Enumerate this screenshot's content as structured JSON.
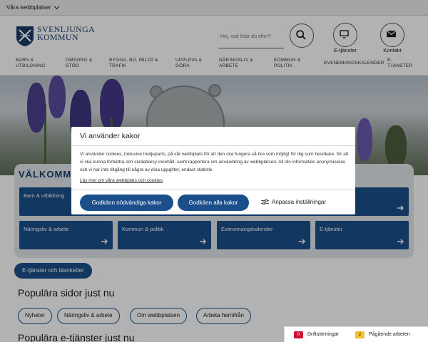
{
  "topbar": {
    "platforms_label": "Våra webbplatser"
  },
  "header": {
    "logo_line1": "SVENLJUNGA",
    "logo_line2": "KOMMUN",
    "search_placeholder": "Hej, vad letar du efter?",
    "etjanster_label": "E-tjänster",
    "kontakt_label": "Kontakt"
  },
  "nav": {
    "items": [
      {
        "line1": "Barn &",
        "line2": "utbildning"
      },
      {
        "line1": "Omsorg &",
        "line2": "stöd"
      },
      {
        "line1": "Bygga, bo, miljö &",
        "line2": "trafik"
      },
      {
        "line1": "Uppleva &",
        "line2": "göra"
      },
      {
        "line1": "Näringsliv &",
        "line2": "arbete"
      },
      {
        "line1": "Kommun &",
        "line2": "politik"
      },
      {
        "line1": "Evenemangskalender",
        "line2": ""
      },
      {
        "line1": "E-",
        "line2": "tjänster"
      }
    ]
  },
  "main": {
    "welcome": "Välkomme",
    "tiles_row1": [
      "Barn & utbildning"
    ],
    "tiles_row2": [
      "Näringsliv & arbete",
      "Kommun & politik",
      "Evenemangskalender",
      "E-tjänster"
    ],
    "etj_button": "E-tjänster och blanketter",
    "popular_heading": "Populära sidor just nu",
    "chips": [
      "Nyheter",
      "Näringsliv & arbete",
      "Om webbplatsen",
      "Arbeta hemifrån"
    ],
    "popular_eservices_heading": "Populära e-tjänster just nu"
  },
  "status": {
    "drift_count": "0",
    "drift_label": "Driftstörningar",
    "work_count": "2",
    "work_label": "Pågående arbeten",
    "drift_color": "#c8102e",
    "work_color": "#f2c230"
  },
  "cookie": {
    "title": "Vi använder kakor",
    "text": "Vi använder cookies, inklusive tredjeparts, på vår webbplats för att den ska fungera så bra som möjligt för dig som besökare, för att vi ska kunna förbättra och skräddarsy innehåll, samt rapportera om användning av webbplatsen. All din information anonymiseras och vi har inte tillgång till några av dina uppgifter, endast statistik.",
    "link": "Läs mer om våra webbplats och cookies",
    "btn_necessary": "Godkänn nödvändiga kakor",
    "btn_all": "Godkänn alla kakor",
    "btn_customize": "Anpassa inställningar"
  },
  "colors": {
    "primary": "#1b4f8c",
    "brand": "#1b3d6b"
  }
}
